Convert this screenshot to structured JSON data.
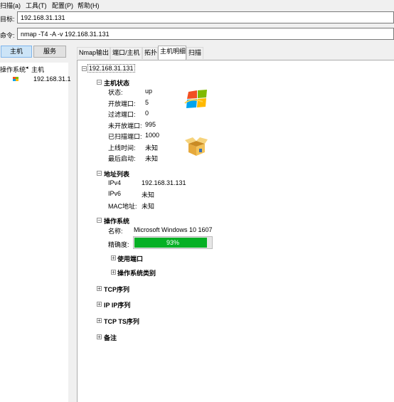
{
  "menu": [
    "扫描(a)",
    "工具(T)",
    "配置(P)",
    "帮助(H)"
  ],
  "target": {
    "label": "目标:",
    "value": "192.168.31.131"
  },
  "command": {
    "label": "命令:",
    "value": "nmap -T4 -A -v 192.168.31.131"
  },
  "left_buttons": {
    "hosts": "主机",
    "services": "服务"
  },
  "left_header": {
    "os": "操作系统",
    "host": "主机"
  },
  "left_host": "192.168.31.1",
  "tabs": [
    "Nmap输出",
    "端口/主机",
    "拓扑",
    "主机明细",
    "扫描"
  ],
  "host_title": "192.168.31.131",
  "status": {
    "title": "主机状态",
    "rows": [
      {
        "label": "状态:",
        "value": "up"
      },
      {
        "label": "开放端口:",
        "value": "5"
      },
      {
        "label": "过滤端口:",
        "value": "0"
      },
      {
        "label": "未开放端口:",
        "value": "995"
      },
      {
        "label": "已扫描端口:",
        "value": "1000"
      },
      {
        "label": "上线时间:",
        "value": "未知"
      },
      {
        "label": "最后启动:",
        "value": "未知"
      }
    ]
  },
  "addresses": {
    "title": "地址列表",
    "rows": [
      {
        "label": "IPv4",
        "value": "192.168.31.131"
      },
      {
        "label": "IPv6",
        "value": "未知"
      },
      {
        "label": "MAC地址:",
        "value": "未知"
      }
    ]
  },
  "os": {
    "title": "操作系统",
    "name_label": "名称:",
    "name_value": "Microsoft Windows 10 1607",
    "accuracy_label": "精确度:",
    "accuracy_text": "93%",
    "accuracy": 0.93,
    "used_ports": "使用端口",
    "os_class": "操作系统类别"
  },
  "sections": {
    "tcp_seq": "TCP序列",
    "ip_seq": "IP IP序列",
    "tcp_ts": "TCP TS序列",
    "notes": "备注"
  },
  "colors": {
    "progress_fill": "#06b025",
    "selection": "#cce4f7"
  },
  "icons": [
    "windows-logo-icon",
    "open-box-icon"
  ]
}
